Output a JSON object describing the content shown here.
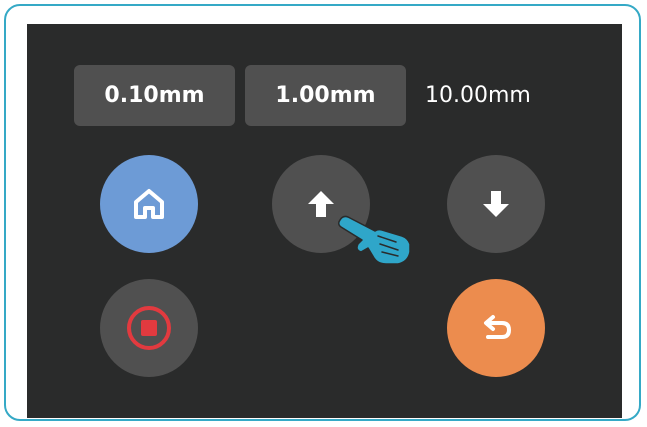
{
  "step_options": [
    "0.10mm",
    "1.00mm",
    "10.00mm"
  ],
  "colors": {
    "frame_border": "#35a9c6",
    "screen_bg": "#2a2b2b",
    "button_gray": "#505050",
    "home_blue": "#6d9bd6",
    "back_orange": "#ec8c4e",
    "stop_red": "#e23a3f",
    "hand_cyan": "#2fa6c9"
  },
  "icons": {
    "home": "home-icon",
    "up": "arrow-up-icon",
    "down": "arrow-down-icon",
    "stop": "stop-icon",
    "back": "return-icon",
    "pointer": "pointing-hand-icon"
  }
}
